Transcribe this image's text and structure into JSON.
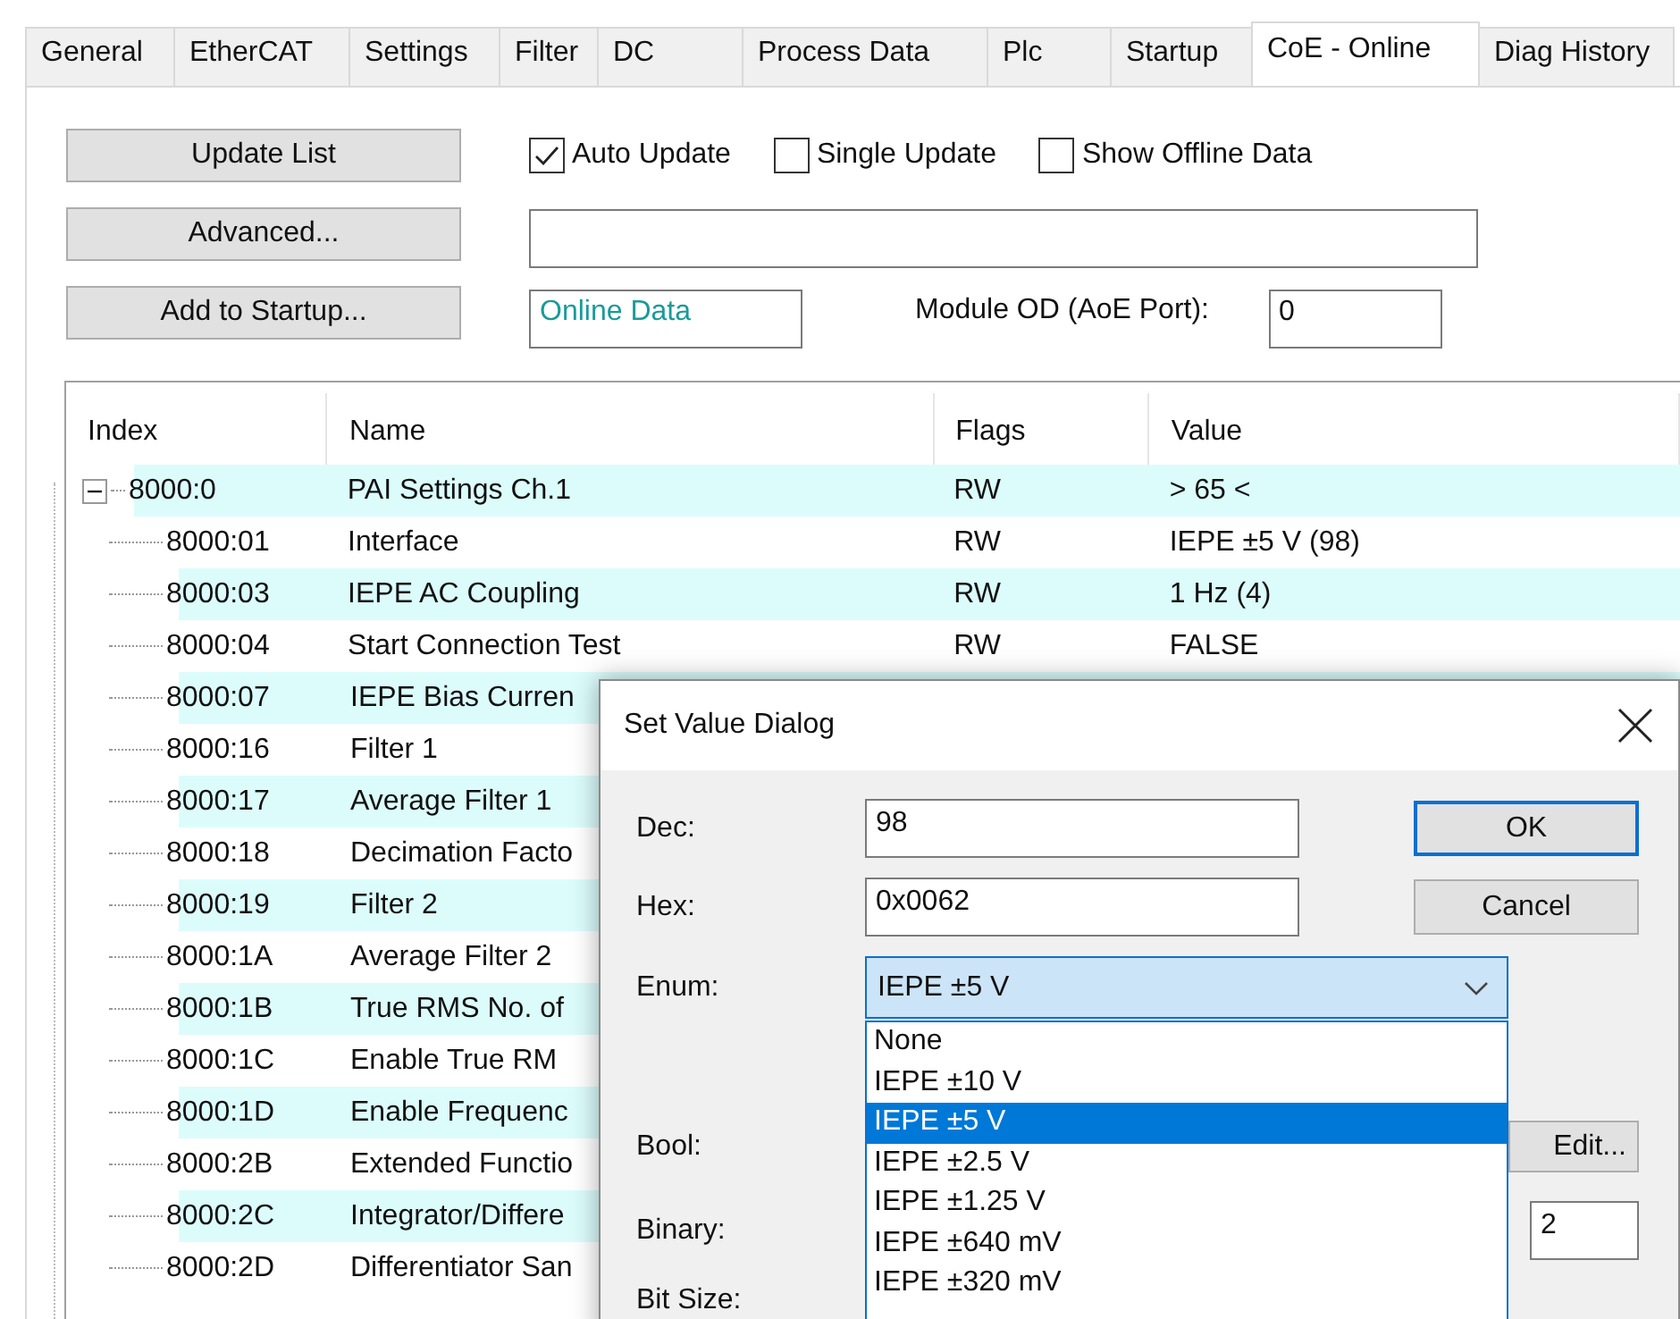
{
  "tabs": [
    {
      "label": "General",
      "selected": false
    },
    {
      "label": "EtherCAT",
      "selected": false
    },
    {
      "label": "Settings",
      "selected": false
    },
    {
      "label": "Filter",
      "selected": false
    },
    {
      "label": "DC",
      "selected": false
    },
    {
      "label": "Process Data",
      "selected": false
    },
    {
      "label": "Plc",
      "selected": false
    },
    {
      "label": "Startup",
      "selected": false
    },
    {
      "label": "CoE - Online",
      "selected": true
    },
    {
      "label": "Diag History",
      "selected": false
    }
  ],
  "actions": [
    "Update List",
    "Advanced...",
    "Add to Startup..."
  ],
  "options": [
    {
      "label": "Auto Update",
      "checked": true
    },
    {
      "label": "Single Update",
      "checked": false
    },
    {
      "label": "Show Offline Data",
      "checked": false
    }
  ],
  "status_field": {
    "value": "Online Data"
  },
  "module_od": {
    "label": "Module OD (AoE Port):",
    "value": "0"
  },
  "table": {
    "columns": [
      "Index",
      "Name",
      "Flags",
      "Value"
    ],
    "rows": [
      {
        "index": "8000:0",
        "name": "PAI Settings Ch.1",
        "flags": "RW",
        "value": "> 65 <",
        "expanded": true,
        "children": [
          {
            "index": "8000:01",
            "name": "Interface",
            "flags": "RW",
            "value": "IEPE ±5 V (98)"
          },
          {
            "index": "8000:03",
            "name": "IEPE AC Coupling",
            "flags": "RW",
            "value": "1 Hz (4)"
          },
          {
            "index": "8000:04",
            "name": "Start Connection Test",
            "flags": "RW",
            "value": "FALSE"
          },
          {
            "index": "8000:07",
            "name": "IEPE Bias Curren"
          },
          {
            "index": "8000:16",
            "name": "Filter 1"
          },
          {
            "index": "8000:17",
            "name": "Average Filter 1"
          },
          {
            "index": "8000:18",
            "name": "Decimation Facto"
          },
          {
            "index": "8000:19",
            "name": "Filter 2"
          },
          {
            "index": "8000:1A",
            "name": "Average Filter 2"
          },
          {
            "index": "8000:1B",
            "name": "True RMS No. of"
          },
          {
            "index": "8000:1C",
            "name": "Enable True RM"
          },
          {
            "index": "8000:1D",
            "name": "Enable Frequenc"
          },
          {
            "index": "8000:2B",
            "name": "Extended Functio"
          },
          {
            "index": "8000:2C",
            "name": "Integrator/Differe"
          },
          {
            "index": "8000:2D",
            "name": "Differentiator San"
          }
        ]
      }
    ]
  },
  "dialog": {
    "title": "Set Value Dialog",
    "fields": [
      {
        "label": "Dec:",
        "value": "98"
      },
      {
        "label": "Hex:",
        "value": "0x0062"
      }
    ],
    "buttons": [
      {
        "label": "OK",
        "default": true
      },
      {
        "label": "Cancel",
        "default": false
      }
    ],
    "enum": {
      "label": "Enum:",
      "value": "IEPE ±5 V",
      "expanded": true,
      "options": [
        {
          "label": "None",
          "selected": false
        },
        {
          "label": "IEPE ±10 V",
          "selected": false
        },
        {
          "label": "IEPE ±5 V",
          "selected": true
        },
        {
          "label": "IEPE ±2.5 V",
          "selected": false
        },
        {
          "label": "IEPE ±1.25 V",
          "selected": false
        },
        {
          "label": "IEPE ±640 mV",
          "selected": false
        },
        {
          "label": "IEPE ±320 mV",
          "selected": false
        }
      ]
    },
    "bool_label": "Bool:",
    "edit_button": "Edit...",
    "binary_label": "Binary:",
    "binary_size": "2",
    "bit_size_label": "Bit Size:"
  }
}
